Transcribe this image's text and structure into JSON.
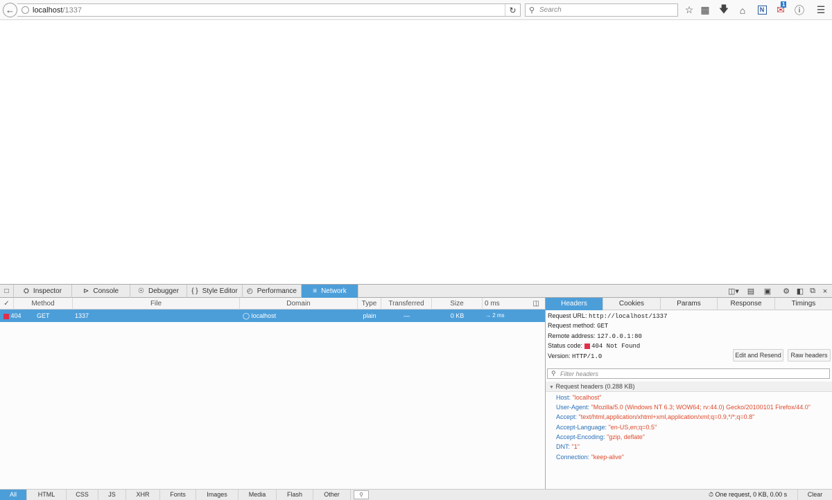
{
  "browser": {
    "url_host": "localhost",
    "url_rest": "/1337",
    "search_placeholder": "Search",
    "mail_badge": "1"
  },
  "devtools": {
    "tabs": [
      "Inspector",
      "Console",
      "Debugger",
      "Style Editor",
      "Performance",
      "Network"
    ],
    "active_tab": "Network",
    "columns": [
      "✓",
      "Method",
      "File",
      "Domain",
      "Type",
      "Transferred",
      "Size",
      "0 ms"
    ],
    "request": {
      "status": "404",
      "status_color": "#e0304a",
      "method": "GET",
      "file": "1337",
      "domain": "localhost",
      "type": "plain",
      "transferred": "—",
      "size": "0 KB",
      "timing": "→ 2 ms"
    },
    "side_tabs": [
      "Headers",
      "Cookies",
      "Params",
      "Response",
      "Timings"
    ],
    "active_side_tab": "Headers",
    "summary": {
      "request_url_label": "Request URL:",
      "request_url": "http://localhost/1337",
      "method_label": "Request method:",
      "method": "GET",
      "remote_label": "Remote address:",
      "remote": "127.0.0.1:80",
      "status_label": "Status code:",
      "status": "404 Not Found",
      "version_label": "Version:",
      "version": "HTTP/1.0"
    },
    "buttons": {
      "edit_resend": "Edit and Resend",
      "raw_headers": "Raw headers"
    },
    "filter_placeholder": "Filter headers",
    "request_headers_title": "Request headers (0.288 KB)",
    "headers": [
      {
        "key": "Host:",
        "value": "\"localhost\""
      },
      {
        "key": "User-Agent:",
        "value": "\"Mozilla/5.0 (Windows NT 6.3; WOW64; rv:44.0) Gecko/20100101 Firefox/44.0\""
      },
      {
        "key": "Accept:",
        "value": "\"text/html,application/xhtml+xml,application/xml;q=0.9,*/*;q=0.8\""
      },
      {
        "key": "Accept-Language:",
        "value": "\"en-US,en;q=0.5\""
      },
      {
        "key": "Accept-Encoding:",
        "value": "\"gzip, deflate\""
      },
      {
        "key": "DNT:",
        "value": "\"1\""
      },
      {
        "key": "Connection:",
        "value": "\"keep-alive\""
      }
    ],
    "filters": [
      "All",
      "HTML",
      "CSS",
      "JS",
      "XHR",
      "Fonts",
      "Images",
      "Media",
      "Flash",
      "Other"
    ],
    "active_filter": "All",
    "footer_summary": "One request, 0 KB, 0.00 s",
    "clear_label": "Clear"
  }
}
